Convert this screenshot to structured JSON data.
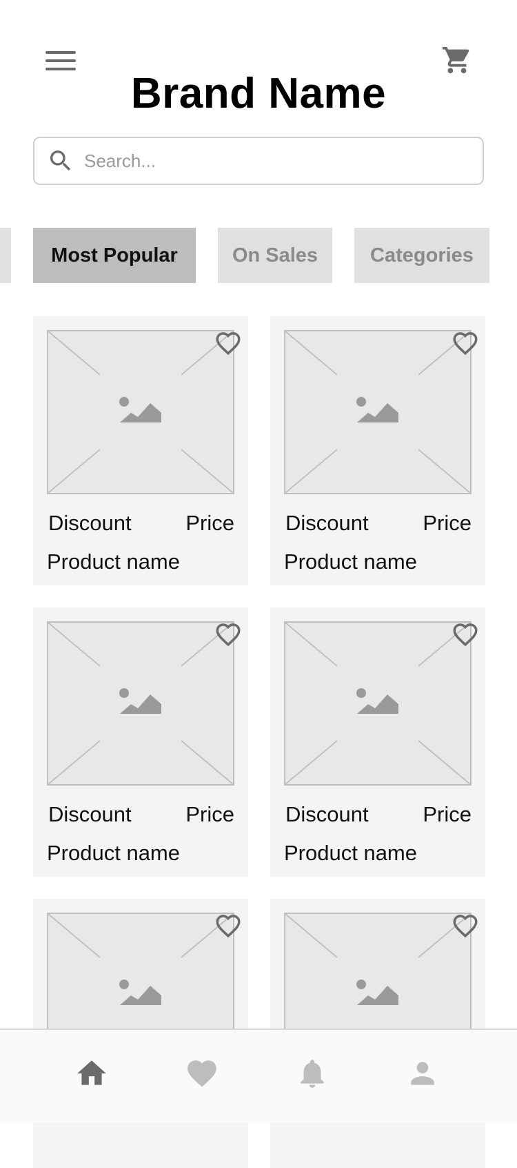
{
  "header": {
    "brand": "Brand Name"
  },
  "search": {
    "placeholder": "Search..."
  },
  "tabs": [
    {
      "label": "Most Popular",
      "selected": true
    },
    {
      "label": "On Sales",
      "selected": false
    },
    {
      "label": "Categories",
      "selected": false
    }
  ],
  "products": [
    {
      "discount": "Discount",
      "price": "Price",
      "name": "Product name"
    },
    {
      "discount": "Discount",
      "price": "Price",
      "name": "Product name"
    },
    {
      "discount": "Discount",
      "price": "Price",
      "name": "Product name"
    },
    {
      "discount": "Discount",
      "price": "Price",
      "name": "Product name"
    },
    {
      "discount": "",
      "price": "",
      "name": ""
    },
    {
      "discount": "",
      "price": "",
      "name": ""
    }
  ],
  "bottom_nav": [
    {
      "icon": "home-icon",
      "active": true
    },
    {
      "icon": "heart-icon",
      "active": false
    },
    {
      "icon": "bell-icon",
      "active": false
    },
    {
      "icon": "user-icon",
      "active": false
    }
  ],
  "colors": {
    "active_tab": "#bdbdbd",
    "inactive_tab": "#e0e0e0",
    "icon_active": "#6b6b6b",
    "icon_inactive": "#bdbdbd"
  }
}
